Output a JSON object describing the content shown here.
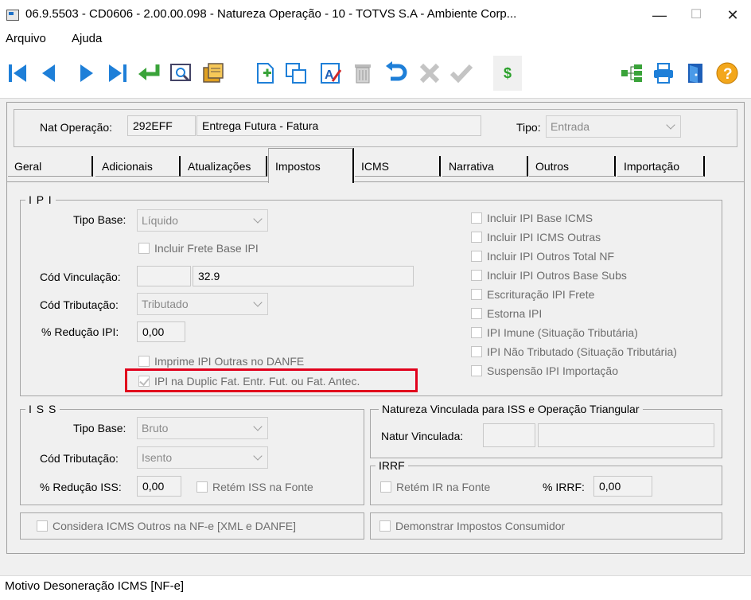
{
  "window": {
    "title": "06.9.5503 - CD0606 - 2.00.00.098 - Natureza Operação - 10 - TOTVS S.A - Ambiente Corp...",
    "minimize": "—",
    "maximize": "☐",
    "close": "✕"
  },
  "menu": [
    "Arquivo",
    "Ajuda"
  ],
  "toolbar": {
    "icons": [
      "first-record-icon",
      "prev-record-icon",
      "next-record-icon",
      "last-record-icon",
      "go-to-icon",
      "search-icon",
      "list-icon",
      "new-icon",
      "copy-icon",
      "edit-icon",
      "delete-icon",
      "undo-icon",
      "cancel-icon",
      "save-icon",
      "dollar-icon",
      "tree-icon",
      "print-icon",
      "exit-icon",
      "help-icon"
    ],
    "dollar": "$",
    "help": "?"
  },
  "header": {
    "nat_label": "Nat Operação:",
    "nat_code": "292EFF",
    "nat_desc": "Entrega Futura - Fatura",
    "tipo_label": "Tipo:",
    "tipo_value": "Entrada"
  },
  "tabs": [
    "Geral",
    "Adicionais",
    "Atualizações",
    "Impostos",
    "ICMS",
    "Narrativa",
    "Outros",
    "Importação"
  ],
  "ipi": {
    "title": "I P I",
    "tipo_base_label": "Tipo Base:",
    "tipo_base_value": "Líquido",
    "incluir_frete": "Incluir Frete Base IPI",
    "cod_vinc_label": "Cód Vinculação:",
    "cod_vinc_value": "",
    "cod_vinc_desc": "32.9",
    "cod_trib_label": "Cód Tributação:",
    "cod_trib_value": "Tributado",
    "reducao_label": "% Redução IPI:",
    "reducao_value": "0,00",
    "imprime_outras": "Imprime IPI Outras no DANFE",
    "ipi_duplic": "IPI na Duplic Fat. Entr. Fut. ou Fat. Antec.",
    "right_checks": [
      "Incluir IPI Base ICMS",
      "Incluir IPI ICMS Outras",
      "Incluir IPI Outros Total NF",
      "Incluir IPI Outros Base Subs",
      "Escrituração IPI Frete",
      "Estorna IPI",
      "IPI Imune (Situação Tributária)",
      "IPI Não Tributado (Situação Tributária)",
      "Suspensão IPI Importação"
    ]
  },
  "iss": {
    "title": "I S S",
    "tipo_base_label": "Tipo Base:",
    "tipo_base_value": "Bruto",
    "cod_trib_label": "Cód Tributação:",
    "cod_trib_value": "Isento",
    "reducao_label": "% Redução ISS:",
    "reducao_value": "0,00",
    "retem": "Retém ISS na Fonte"
  },
  "natureza_vinc": {
    "title": "Natureza Vinculada para ISS e Operação Triangular",
    "label": "Natur Vinculada:"
  },
  "irrf": {
    "title": "IRRF",
    "retem": "Retém IR na Fonte",
    "perc_label": "% IRRF:",
    "perc_value": "0,00"
  },
  "bottom": {
    "considera": "Considera ICMS Outros na NF-e [XML e DANFE]",
    "demonstrar": "Demonstrar Impostos Consumidor"
  },
  "status": "Motivo Desoneração ICMS [NF-e]"
}
